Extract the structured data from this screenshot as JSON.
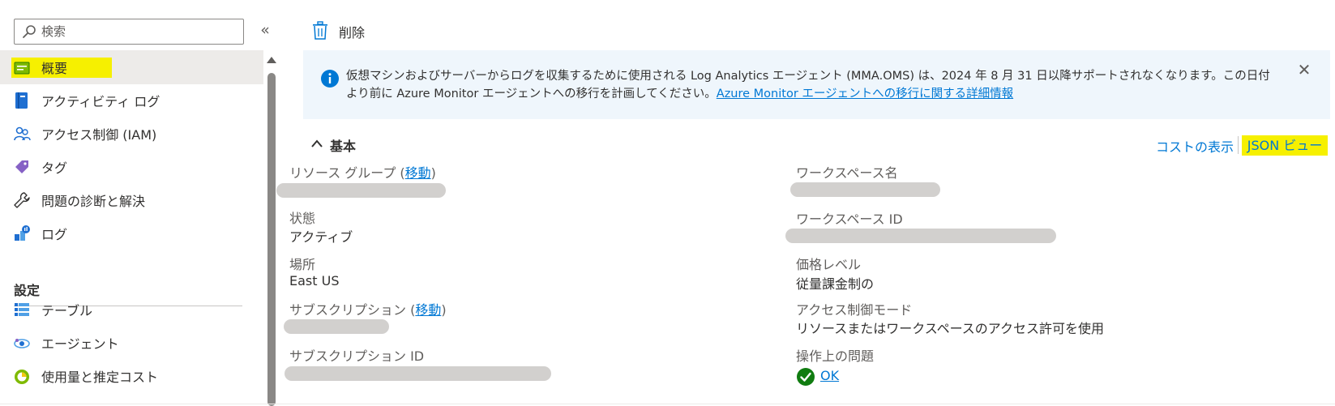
{
  "search": {
    "placeholder": "検索"
  },
  "sidebar": {
    "collapse_glyph": "«",
    "items": [
      {
        "label": "概要",
        "icon": "overview-icon",
        "active": true
      },
      {
        "label": "アクティビティ ログ",
        "icon": "activity-log-icon"
      },
      {
        "label": "アクセス制御 (IAM)",
        "icon": "iam-icon"
      },
      {
        "label": "タグ",
        "icon": "tag-icon"
      },
      {
        "label": "問題の診断と解決",
        "icon": "wrench-icon"
      },
      {
        "label": "ログ",
        "icon": "logs-icon"
      }
    ],
    "section_settings": "設定",
    "settings_items": [
      {
        "label": "テーブル",
        "icon": "table-icon"
      },
      {
        "label": "エージェント",
        "icon": "agent-icon"
      },
      {
        "label": "使用量と推定コスト",
        "icon": "usage-cost-icon"
      }
    ]
  },
  "toolbar": {
    "delete_label": "削除"
  },
  "banner": {
    "message": "仮想マシンおよびサーバーからログを収集するために使用される Log Analytics エージェント (MMA.OMS) は、2024 年 8 月 31 日以降サポートされなくなります。この日付より前に Azure Monitor エージェントへの移行を計画してください。",
    "link": "Azure Monitor エージェントへの移行に関する詳細情報",
    "close_glyph": "✕"
  },
  "essentials": {
    "title": "基本",
    "cost_link": "コストの表示",
    "json_link": "JSON ビュー",
    "left": {
      "resource_group_label": "リソース グループ (",
      "resource_group_link": "移動",
      "resource_group_suffix": ")",
      "status_label": "状態",
      "status_value": "アクティブ",
      "location_label": "場所",
      "location_value": "East US",
      "subscription_label": "サブスクリプション (",
      "subscription_link": "移動",
      "subscription_suffix": ")",
      "subscription_id_label": "サブスクリプション ID"
    },
    "right": {
      "workspace_name_label": "ワークスペース名",
      "workspace_id_label": "ワークスペース ID",
      "pricing_tier_label": "価格レベル",
      "pricing_tier_value": "従量課金制の",
      "access_mode_label": "アクセス制御モード",
      "access_mode_value": "リソースまたはワークスペースのアクセス許可を使用",
      "operational_issues_label": "操作上の問題",
      "operational_issues_value": "OK"
    }
  },
  "colors": {
    "accent": "#0078d4",
    "highlight": "#f6f000",
    "banner_bg": "#eff6fc",
    "ok_green": "#107c10"
  }
}
